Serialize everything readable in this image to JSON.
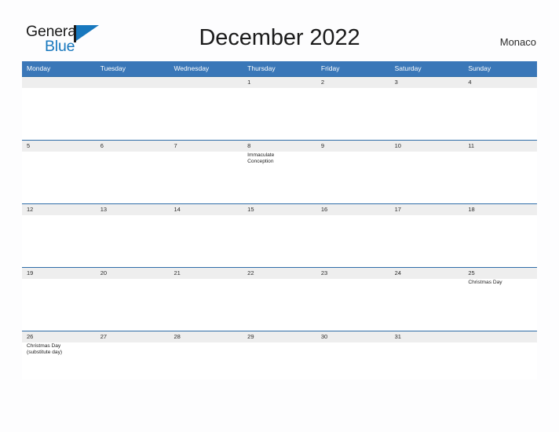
{
  "brand": {
    "name_part1": "General",
    "name_part2": "Blue",
    "flag_icon": "flag-icon",
    "accent_color": "#1878be"
  },
  "header": {
    "title": "December 2022",
    "location": "Monaco"
  },
  "theme": {
    "header_bar_color": "#3a77b8",
    "week_rule_color": "#2f6da8",
    "date_strip_color": "#eeeeee",
    "page_background": "#fdfdfe"
  },
  "calendar": {
    "weekdays": [
      "Monday",
      "Tuesday",
      "Wednesday",
      "Thursday",
      "Friday",
      "Saturday",
      "Sunday"
    ],
    "weeks": [
      {
        "days": [
          {
            "num": "",
            "event": ""
          },
          {
            "num": "",
            "event": ""
          },
          {
            "num": "",
            "event": ""
          },
          {
            "num": "1",
            "event": ""
          },
          {
            "num": "2",
            "event": ""
          },
          {
            "num": "3",
            "event": ""
          },
          {
            "num": "4",
            "event": ""
          }
        ]
      },
      {
        "days": [
          {
            "num": "5",
            "event": ""
          },
          {
            "num": "6",
            "event": ""
          },
          {
            "num": "7",
            "event": ""
          },
          {
            "num": "8",
            "event": "Immaculate\nConception"
          },
          {
            "num": "9",
            "event": ""
          },
          {
            "num": "10",
            "event": ""
          },
          {
            "num": "11",
            "event": ""
          }
        ]
      },
      {
        "days": [
          {
            "num": "12",
            "event": ""
          },
          {
            "num": "13",
            "event": ""
          },
          {
            "num": "14",
            "event": ""
          },
          {
            "num": "15",
            "event": ""
          },
          {
            "num": "16",
            "event": ""
          },
          {
            "num": "17",
            "event": ""
          },
          {
            "num": "18",
            "event": ""
          }
        ]
      },
      {
        "days": [
          {
            "num": "19",
            "event": ""
          },
          {
            "num": "20",
            "event": ""
          },
          {
            "num": "21",
            "event": ""
          },
          {
            "num": "22",
            "event": ""
          },
          {
            "num": "23",
            "event": ""
          },
          {
            "num": "24",
            "event": ""
          },
          {
            "num": "25",
            "event": "Christmas Day"
          }
        ]
      },
      {
        "days": [
          {
            "num": "26",
            "event": "Christmas Day\n(substitute day)"
          },
          {
            "num": "27",
            "event": ""
          },
          {
            "num": "28",
            "event": ""
          },
          {
            "num": "29",
            "event": ""
          },
          {
            "num": "30",
            "event": ""
          },
          {
            "num": "31",
            "event": ""
          },
          {
            "num": "",
            "event": ""
          }
        ]
      }
    ]
  }
}
